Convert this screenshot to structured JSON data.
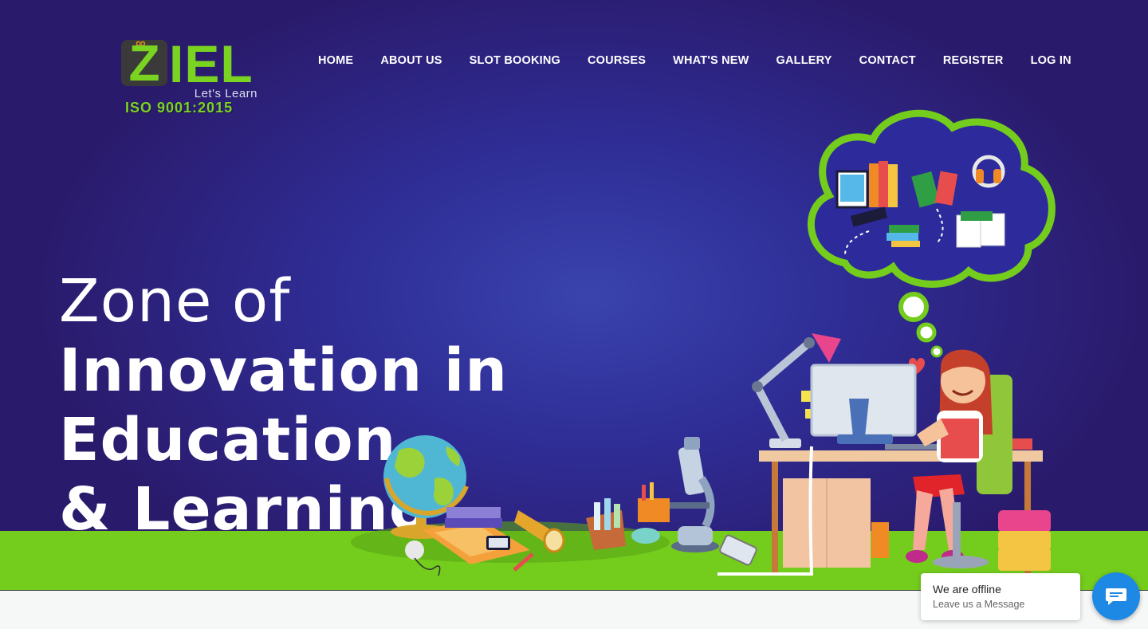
{
  "brand": {
    "logo_z": "Z",
    "logo_rest": "IEL",
    "tagline": "Let's Learn",
    "certification": "ISO 9001:2015"
  },
  "nav": {
    "items": [
      {
        "label": "HOME"
      },
      {
        "label": "ABOUT US"
      },
      {
        "label": "SLOT BOOKING"
      },
      {
        "label": "COURSES"
      },
      {
        "label": "WHAT'S NEW"
      },
      {
        "label": "GALLERY"
      },
      {
        "label": "CONTACT"
      },
      {
        "label": "REGISTER"
      },
      {
        "label": "LOG IN"
      }
    ]
  },
  "hero": {
    "line1": "Zone of",
    "line2": "Innovation in Education",
    "line3": "& Learning"
  },
  "chat": {
    "status": "We are offline",
    "prompt": "Leave us a Message"
  },
  "colors": {
    "brand_green": "#7ad321",
    "hero_purple": "#2f2d96",
    "chat_blue": "#1e88e5"
  }
}
